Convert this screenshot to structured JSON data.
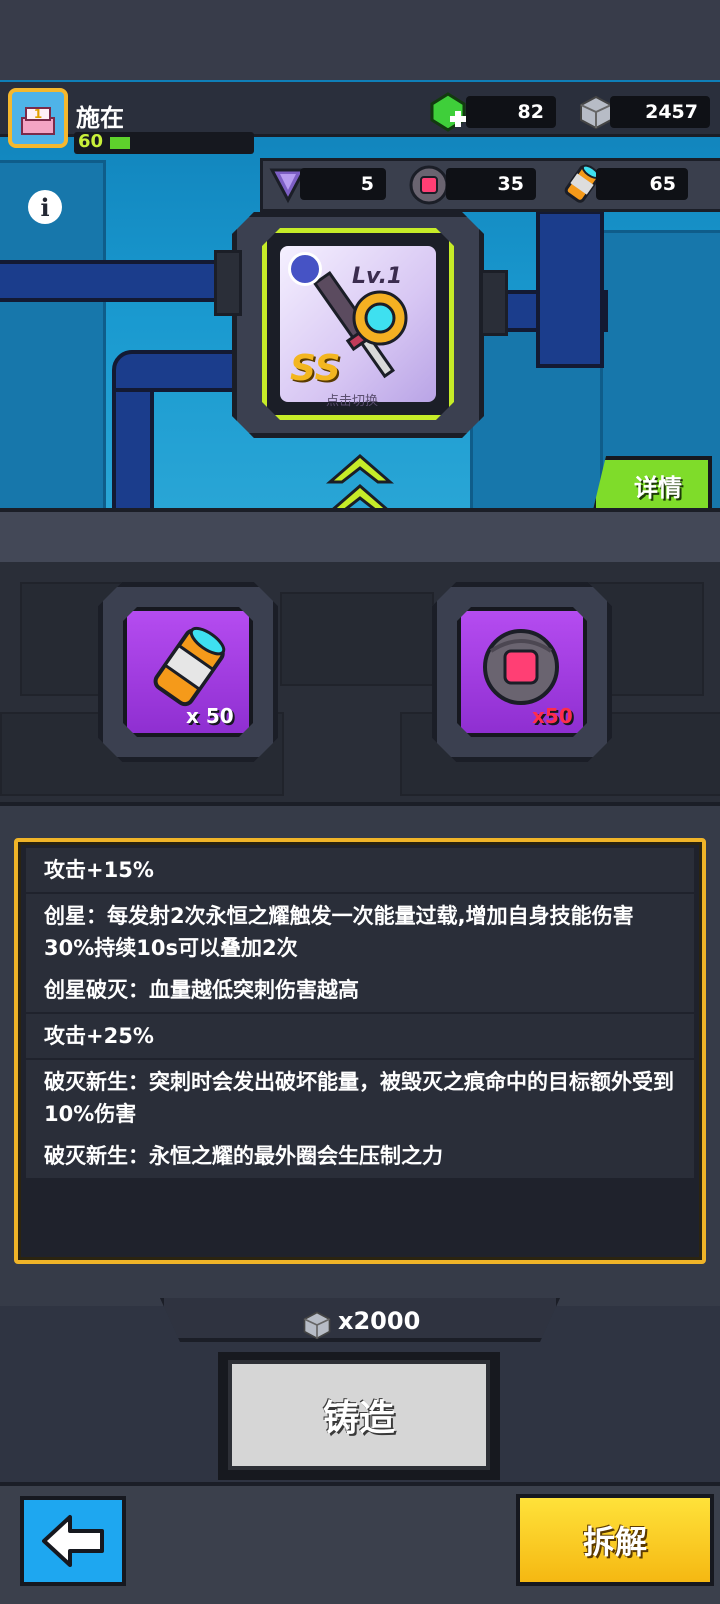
{
  "player": {
    "name": "施在",
    "level": "60",
    "avatar_badge": "1",
    "level_progress": 0.1
  },
  "currencies": {
    "gems": "82",
    "cubes": "2457"
  },
  "resources": {
    "crystal": "5",
    "orb": "35",
    "cylinder": "65"
  },
  "item": {
    "level_label": "Lv.1",
    "grade": "SS",
    "switch_hint": "点击切换"
  },
  "detail_button": "详情",
  "materials": [
    {
      "icon": "cylinder-material-icon",
      "qty": "x 50",
      "qty_color": "#ffffff"
    },
    {
      "icon": "orb-material-icon",
      "qty": "x50",
      "qty_color": "#ff2d4c"
    }
  ],
  "descriptions": [
    "攻击+15%",
    "创星：每发射2次永恒之耀触发一次能量过载,增加自身技能伤害30%持续10s可以叠加2次",
    "创星破灭：血量越低突刺伤害越高",
    "攻击+25%",
    "破灭新生：突刺时会发出破坏能量，被毁灭之痕命中的目标额外受到10%伤害",
    "破灭新生：永恒之耀的最外圈会生压制之力"
  ],
  "cost": "x2000",
  "forge_button": "铸造",
  "dismantle_button": "拆解",
  "colors": {
    "accent_green": "#7fdc2a",
    "panel_border": "#f0b428",
    "slot_purple": "#a93fe6",
    "back_blue": "#1ea7f0",
    "dismantle_yellow": "#f5c21a"
  }
}
